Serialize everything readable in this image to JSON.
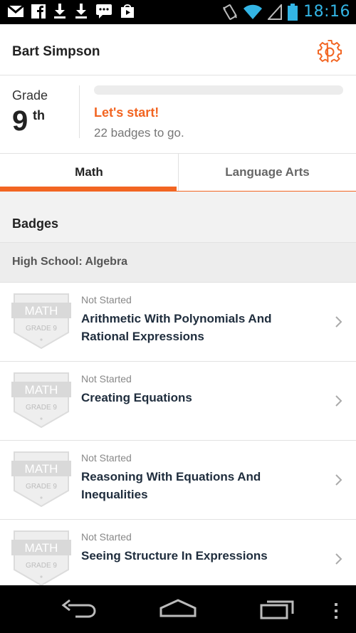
{
  "status_bar": {
    "time": "18:16",
    "left_icons": [
      "gmail-icon",
      "facebook-icon",
      "download-icon",
      "download-icon",
      "chat-icon",
      "play-store-icon"
    ],
    "right_icons": [
      "vibrate-icon",
      "wifi-icon",
      "signal-icon",
      "battery-icon"
    ]
  },
  "header": {
    "user_name": "Bart Simpson",
    "settings_icon": "gear-icon",
    "accent_color": "#f26522"
  },
  "grade": {
    "label": "Grade",
    "number": "9",
    "suffix": "th",
    "progress_percent": 0,
    "message": "Let's start!",
    "badges_to_go": "22 badges to go."
  },
  "tabs": [
    {
      "label": "Math",
      "active": true
    },
    {
      "label": "Language Arts",
      "active": false
    }
  ],
  "badges_section": {
    "title": "Badges",
    "subsection": "High School: Algebra",
    "items": [
      {
        "status": "Not Started",
        "title": "Arithmetic With Polynomials And Rational Expressions",
        "badge_subject": "MATH",
        "badge_grade": "GRADE 9"
      },
      {
        "status": "Not Started",
        "title": "Creating Equations",
        "badge_subject": "MATH",
        "badge_grade": "GRADE 9"
      },
      {
        "status": "Not Started",
        "title": "Reasoning With Equations And Inequalities",
        "badge_subject": "MATH",
        "badge_grade": "GRADE 9"
      },
      {
        "status": "Not Started",
        "title": "Seeing Structure In Expressions",
        "badge_subject": "MATH",
        "badge_grade": "GRADE 9"
      }
    ]
  },
  "nav_bar": {
    "icons": [
      "back-icon",
      "home-icon",
      "recents-icon",
      "overflow-menu-icon"
    ]
  }
}
